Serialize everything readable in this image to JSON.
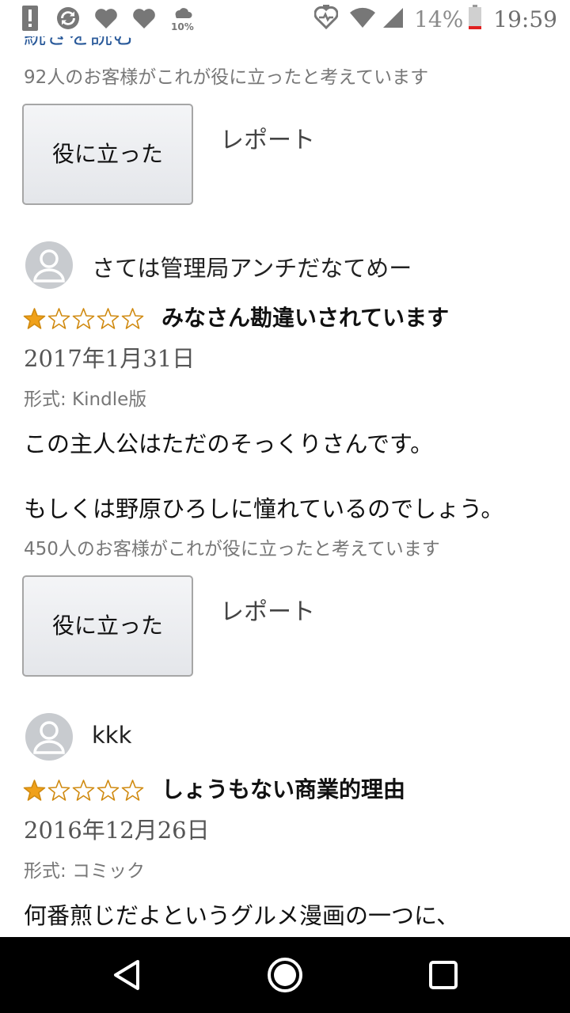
{
  "status_bar": {
    "battery_percent": "14%",
    "time": "19:59",
    "cloud_badge": "10%",
    "icons": [
      "alert-icon",
      "sync-icon",
      "heart-icon",
      "heart-icon",
      "cloud-icon",
      "heart-monitor-icon",
      "wifi-icon",
      "cell-signal-icon",
      "battery-icon"
    ]
  },
  "previous_review": {
    "partial_link": "続きを読む",
    "helpful_count": "92人のお客様がこれが役に立ったと考えています",
    "helpful_button": "役に立った",
    "report_link": "レポート"
  },
  "reviews": [
    {
      "reviewer": "さては管理局アンチだなてめー",
      "rating": 1,
      "max_rating": 5,
      "title": "みなさん勘違いされています",
      "date": "2017年1月31日",
      "format": "形式: Kindle版",
      "body_lines": [
        "この主人公はただのそっくりさんです。",
        "もしくは野原ひろしに憧れているのでしょう。"
      ],
      "helpful_count": "450人のお客様がこれが役に立ったと考えています",
      "helpful_button": "役に立った",
      "report_link": "レポート"
    },
    {
      "reviewer": "kkk",
      "rating": 1,
      "max_rating": 5,
      "title": "しょうもない商業的理由",
      "date": "2016年12月26日",
      "format": "形式: コミック",
      "body_lines": [
        "何番煎じだよというグルメ漫画の一つに、"
      ]
    }
  ],
  "colors": {
    "star_fill": "#f0a11a",
    "star_outline": "#d08a10",
    "avatar_bg": "#c8cbcf",
    "nav_bar": "#000000"
  },
  "nav_bar": {
    "icons": [
      "back-icon",
      "home-icon",
      "recents-icon"
    ]
  }
}
